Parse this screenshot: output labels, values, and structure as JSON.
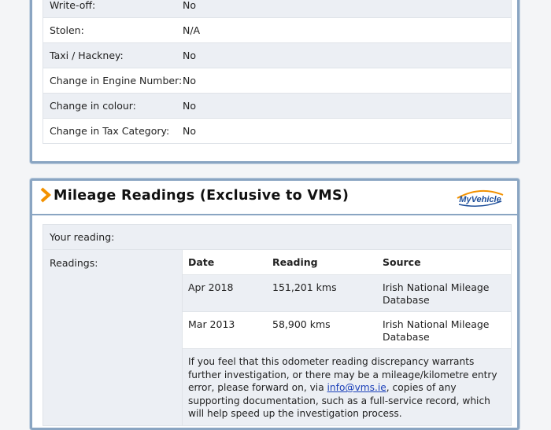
{
  "history": {
    "rows": [
      {
        "label": "Write-off:",
        "value": "No"
      },
      {
        "label": "Stolen:",
        "value": "N/A"
      },
      {
        "label": "Taxi / Hackney:",
        "value": "No"
      },
      {
        "label": "Change in Engine Number:",
        "value": "No"
      },
      {
        "label": "Change in colour:",
        "value": "No"
      },
      {
        "label": "Change in Tax Category:",
        "value": "No"
      }
    ]
  },
  "mileage": {
    "title": "Mileage Readings (Exclusive to VMS)",
    "logo_text": "MyVehicle",
    "your_reading_label": "Your reading:",
    "readings_label": "Readings:",
    "columns": [
      "Date",
      "Reading",
      "Source"
    ],
    "readings": [
      {
        "date": "Apr 2018",
        "reading": "151,201 kms",
        "source": "Irish National Mileage Database"
      },
      {
        "date": "Mar 2013",
        "reading": "58,900 kms",
        "source": "Irish National Mileage Database"
      }
    ],
    "note_before": "If you feel that this odometer reading discrepancy warrants further investigation, or there may be a mileage/kilometre entry error, please forward on, via ",
    "note_link": "info@vms.ie",
    "note_after": ", copies of any supporting documentation, such as a full-service record, which will help speed up the investigation process."
  },
  "colors": {
    "panel_border": "#8aa5c2",
    "shaded_row": "#eceff4",
    "accent_chevron": "#f39200",
    "link": "#1a3fb8"
  }
}
